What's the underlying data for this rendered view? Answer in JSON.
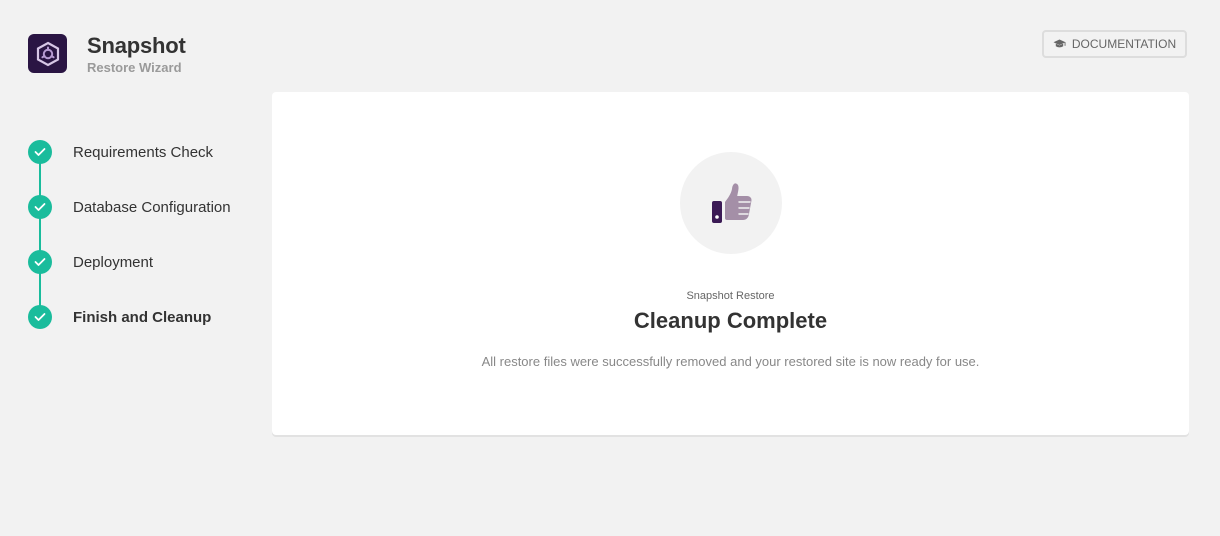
{
  "header": {
    "title": "Snapshot",
    "subtitle": "Restore Wizard",
    "documentation_label": "DOCUMENTATION"
  },
  "steps": [
    {
      "label": "Requirements Check",
      "status": "complete"
    },
    {
      "label": "Database Configuration",
      "status": "complete"
    },
    {
      "label": "Deployment",
      "status": "complete"
    },
    {
      "label": "Finish and Cleanup",
      "status": "complete",
      "current": true
    }
  ],
  "card": {
    "kicker": "Snapshot Restore",
    "title": "Cleanup Complete",
    "description": "All restore files were successfully removed and your restored site is now ready for use.",
    "icon": "thumbs-up-icon"
  },
  "colors": {
    "accent": "#1abc9c",
    "brand": "#2a1543",
    "thumb": "#a48fa7"
  }
}
